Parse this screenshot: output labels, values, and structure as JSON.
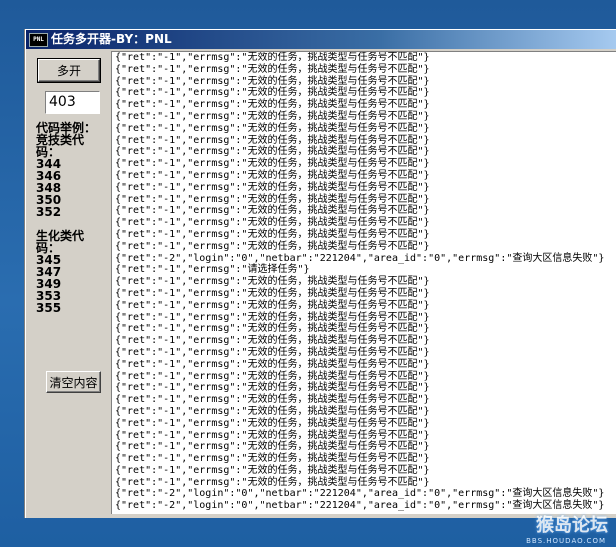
{
  "window": {
    "title": "任务多开器-BY：PNL",
    "icon_text": "PNL"
  },
  "controls": {
    "multi_open_label": "多开",
    "count_value": "403",
    "clear_label": "清空内容"
  },
  "codes": {
    "example_label_1": "代码举例：",
    "competitive_label_1": "竞技类代",
    "competitive_label_2": "码：",
    "competitive": [
      "344",
      "346",
      "348",
      "350",
      "352"
    ],
    "biochem_label_1": "生化类代",
    "biochem_label_2": "码：",
    "biochem": [
      "345",
      "347",
      "349",
      "353",
      "355"
    ]
  },
  "log": {
    "lines": [
      "{\"ret\":\"-1\",\"errmsg\":\"无效的任务，挑战类型与任务号不匹配\"}",
      "{\"ret\":\"-1\",\"errmsg\":\"无效的任务，挑战类型与任务号不匹配\"}",
      "{\"ret\":\"-1\",\"errmsg\":\"无效的任务，挑战类型与任务号不匹配\"}",
      "{\"ret\":\"-1\",\"errmsg\":\"无效的任务，挑战类型与任务号不匹配\"}",
      "{\"ret\":\"-1\",\"errmsg\":\"无效的任务，挑战类型与任务号不匹配\"}",
      "{\"ret\":\"-1\",\"errmsg\":\"无效的任务，挑战类型与任务号不匹配\"}",
      "{\"ret\":\"-1\",\"errmsg\":\"无效的任务，挑战类型与任务号不匹配\"}",
      "{\"ret\":\"-1\",\"errmsg\":\"无效的任务，挑战类型与任务号不匹配\"}",
      "{\"ret\":\"-1\",\"errmsg\":\"无效的任务，挑战类型与任务号不匹配\"}",
      "{\"ret\":\"-1\",\"errmsg\":\"无效的任务，挑战类型与任务号不匹配\"}",
      "{\"ret\":\"-1\",\"errmsg\":\"无效的任务，挑战类型与任务号不匹配\"}",
      "{\"ret\":\"-1\",\"errmsg\":\"无效的任务，挑战类型与任务号不匹配\"}",
      "{\"ret\":\"-1\",\"errmsg\":\"无效的任务，挑战类型与任务号不匹配\"}",
      "{\"ret\":\"-1\",\"errmsg\":\"无效的任务，挑战类型与任务号不匹配\"}",
      "{\"ret\":\"-1\",\"errmsg\":\"无效的任务，挑战类型与任务号不匹配\"}",
      "{\"ret\":\"-1\",\"errmsg\":\"无效的任务，挑战类型与任务号不匹配\"}",
      "{\"ret\":\"-1\",\"errmsg\":\"无效的任务，挑战类型与任务号不匹配\"}",
      "{\"ret\":\"-2\",\"login\":\"0\",\"netbar\":\"221204\",\"area_id\":\"0\",\"errmsg\":\"查询大区信息失败\"}",
      "{\"ret\":\"-1\",\"errmsg\":\"请选择任务\"}",
      "{\"ret\":\"-1\",\"errmsg\":\"无效的任务，挑战类型与任务号不匹配\"}",
      "{\"ret\":\"-1\",\"errmsg\":\"无效的任务，挑战类型与任务号不匹配\"}",
      "{\"ret\":\"-1\",\"errmsg\":\"无效的任务，挑战类型与任务号不匹配\"}",
      "{\"ret\":\"-1\",\"errmsg\":\"无效的任务，挑战类型与任务号不匹配\"}",
      "{\"ret\":\"-1\",\"errmsg\":\"无效的任务，挑战类型与任务号不匹配\"}",
      "{\"ret\":\"-1\",\"errmsg\":\"无效的任务，挑战类型与任务号不匹配\"}",
      "{\"ret\":\"-1\",\"errmsg\":\"无效的任务，挑战类型与任务号不匹配\"}",
      "{\"ret\":\"-1\",\"errmsg\":\"无效的任务，挑战类型与任务号不匹配\"}",
      "{\"ret\":\"-1\",\"errmsg\":\"无效的任务，挑战类型与任务号不匹配\"}",
      "{\"ret\":\"-1\",\"errmsg\":\"无效的任务，挑战类型与任务号不匹配\"}",
      "{\"ret\":\"-1\",\"errmsg\":\"无效的任务，挑战类型与任务号不匹配\"}",
      "{\"ret\":\"-1\",\"errmsg\":\"无效的任务，挑战类型与任务号不匹配\"}",
      "{\"ret\":\"-1\",\"errmsg\":\"无效的任务，挑战类型与任务号不匹配\"}",
      "{\"ret\":\"-1\",\"errmsg\":\"无效的任务，挑战类型与任务号不匹配\"}",
      "{\"ret\":\"-1\",\"errmsg\":\"无效的任务，挑战类型与任务号不匹配\"}",
      "{\"ret\":\"-1\",\"errmsg\":\"无效的任务，挑战类型与任务号不匹配\"}",
      "{\"ret\":\"-1\",\"errmsg\":\"无效的任务，挑战类型与任务号不匹配\"}",
      "{\"ret\":\"-1\",\"errmsg\":\"无效的任务，挑战类型与任务号不匹配\"}",
      "{\"ret\":\"-2\",\"login\":\"0\",\"netbar\":\"221204\",\"area_id\":\"0\",\"errmsg\":\"查询大区信息失败\"}",
      "{\"ret\":\"-2\",\"login\":\"0\",\"netbar\":\"221204\",\"area_id\":\"0\",\"errmsg\":\"查询大区信息失败\"}"
    ]
  },
  "watermark": {
    "text": "猴岛论坛",
    "sub": "BBS.HOUDAO.COM"
  }
}
